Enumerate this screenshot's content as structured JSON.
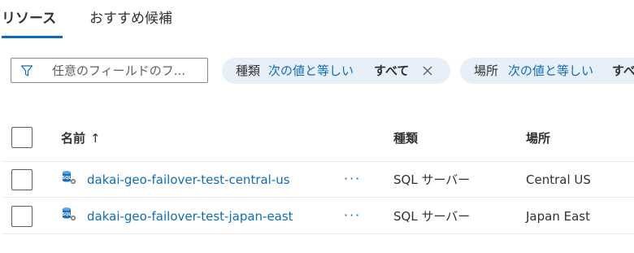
{
  "tabs": {
    "resources": "リソース",
    "recommended": "おすすめ候補"
  },
  "filter": {
    "placeholder": "任意のフィールドのフ...",
    "type_pill": {
      "key": "種類",
      "operator": "次の値と等しい",
      "value": "すべて"
    },
    "location_pill": {
      "key": "場所",
      "operator": "次の値と等しい",
      "value": "すべ"
    }
  },
  "table": {
    "headers": {
      "name": "名前",
      "sort_arrow": "↑",
      "type": "種類",
      "location": "場所"
    },
    "rows": [
      {
        "name": "dakai-geo-failover-test-central-us",
        "more": "···",
        "type": "SQL サーバー",
        "location": "Central US"
      },
      {
        "name": "dakai-geo-failover-test-japan-east",
        "more": "···",
        "type": "SQL サーバー",
        "location": "Japan East"
      }
    ]
  },
  "colors": {
    "accent": "#0f6cbd",
    "pill_bg": "#e7f0f9",
    "text": "#323130"
  },
  "icons": {
    "filter": "funnel-icon",
    "clear": "close-icon",
    "resource": "sql-server-icon"
  }
}
